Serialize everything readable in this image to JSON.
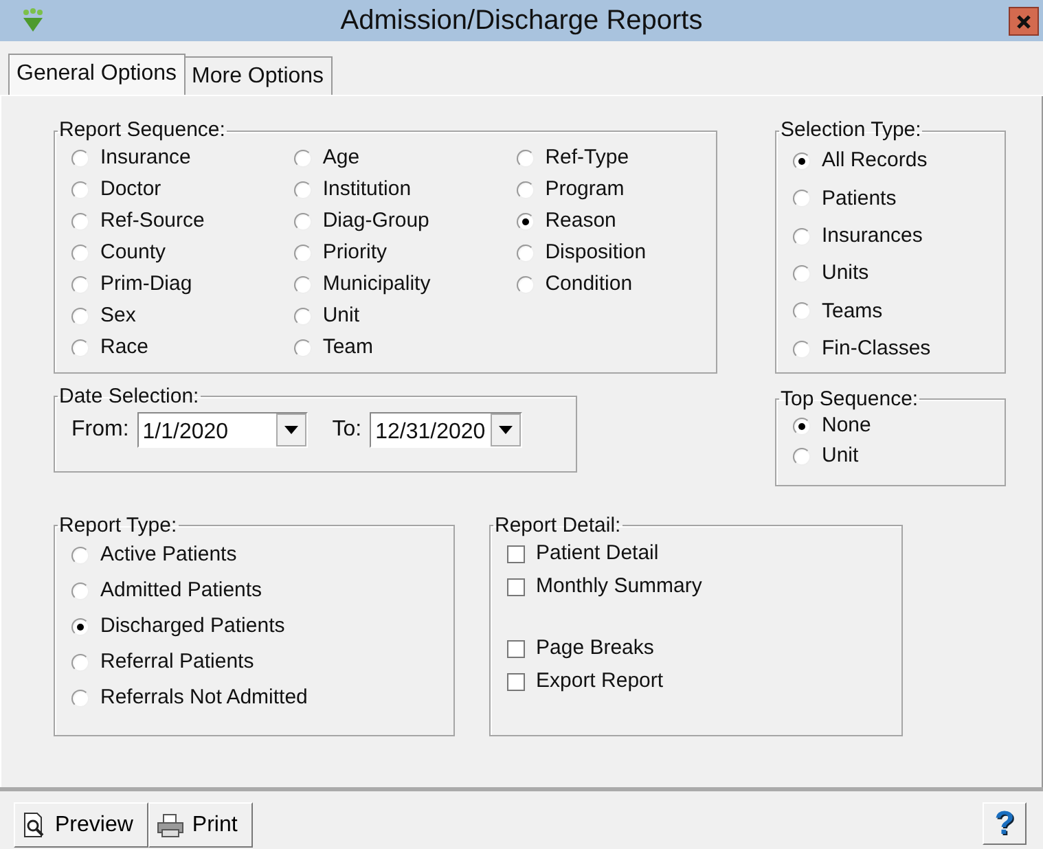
{
  "window": {
    "title": "Admission/Discharge Reports"
  },
  "tabs": [
    {
      "label": "General Options",
      "selected": true
    },
    {
      "label": "More Options",
      "selected": false
    }
  ],
  "report_sequence": {
    "title": "Report Sequence:",
    "columns": [
      [
        {
          "label": "Insurance",
          "selected": false
        },
        {
          "label": "Doctor",
          "selected": false
        },
        {
          "label": "Ref-Source",
          "selected": false
        },
        {
          "label": "County",
          "selected": false
        },
        {
          "label": "Prim-Diag",
          "selected": false
        },
        {
          "label": "Sex",
          "selected": false
        },
        {
          "label": "Race",
          "selected": false
        }
      ],
      [
        {
          "label": "Age",
          "selected": false
        },
        {
          "label": "Institution",
          "selected": false
        },
        {
          "label": "Diag-Group",
          "selected": false
        },
        {
          "label": "Priority",
          "selected": false
        },
        {
          "label": "Municipality",
          "selected": false
        },
        {
          "label": "Unit",
          "selected": false
        },
        {
          "label": "Team",
          "selected": false
        }
      ],
      [
        {
          "label": "Ref-Type",
          "selected": false
        },
        {
          "label": "Program",
          "selected": false
        },
        {
          "label": "Reason",
          "selected": true
        },
        {
          "label": "Disposition",
          "selected": false
        },
        {
          "label": "Condition",
          "selected": false
        }
      ]
    ]
  },
  "selection_type": {
    "title": "Selection Type:",
    "options": [
      {
        "label": "All Records",
        "selected": true
      },
      {
        "label": "Patients",
        "selected": false
      },
      {
        "label": "Insurances",
        "selected": false
      },
      {
        "label": "Units",
        "selected": false
      },
      {
        "label": "Teams",
        "selected": false
      },
      {
        "label": "Fin-Classes",
        "selected": false
      }
    ]
  },
  "date_selection": {
    "title": "Date Selection:",
    "from": {
      "label": "From:",
      "value": "1/1/2020"
    },
    "to": {
      "label": "To:",
      "value": "12/31/2020"
    }
  },
  "top_sequence": {
    "title": "Top Sequence:",
    "options": [
      {
        "label": "None",
        "selected": true
      },
      {
        "label": "Unit",
        "selected": false
      }
    ]
  },
  "report_type": {
    "title": "Report Type:",
    "options": [
      {
        "label": "Active Patients",
        "selected": false
      },
      {
        "label": "Admitted Patients",
        "selected": false
      },
      {
        "label": "Discharged Patients",
        "selected": true
      },
      {
        "label": "Referral Patients",
        "selected": false
      },
      {
        "label": "Referrals Not Admitted",
        "selected": false
      }
    ]
  },
  "report_detail": {
    "title": "Report Detail:",
    "groups": [
      [
        {
          "label": "Patient Detail",
          "checked": false
        },
        {
          "label": "Monthly Summary",
          "checked": false
        }
      ],
      [
        {
          "label": "Page Breaks",
          "checked": false
        },
        {
          "label": "Export Report",
          "checked": false
        }
      ]
    ]
  },
  "buttons": [
    {
      "label": "Preview",
      "kind": "preview"
    },
    {
      "label": "Print",
      "kind": "print"
    }
  ],
  "help": {
    "label": "?"
  }
}
